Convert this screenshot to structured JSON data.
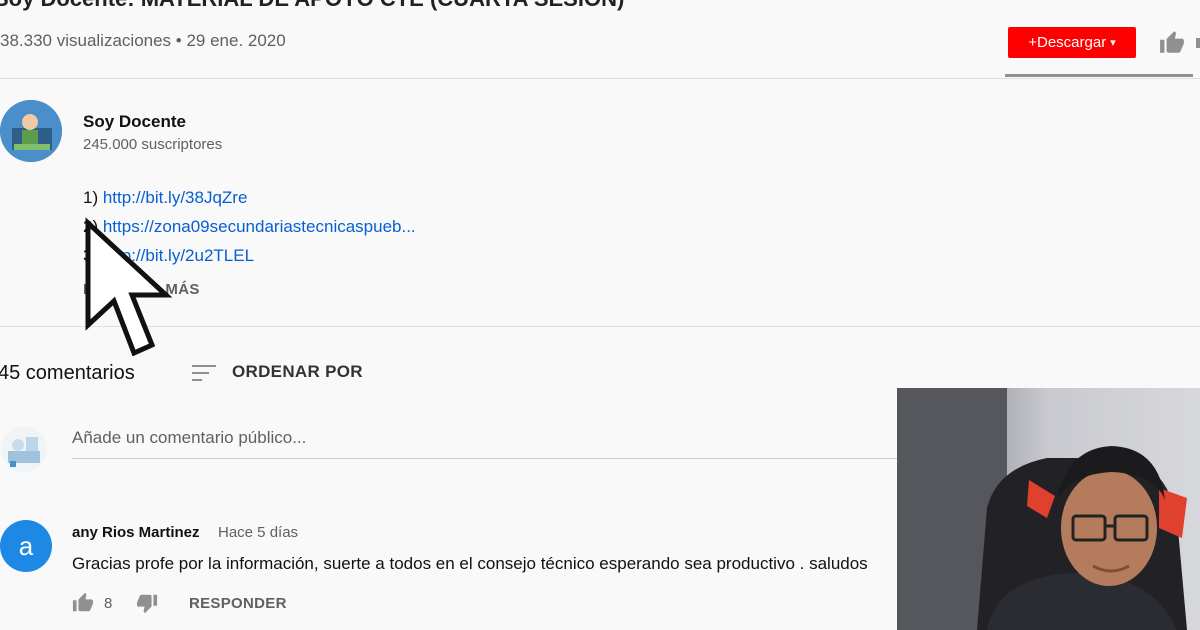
{
  "video": {
    "title": "Soy Docente: MATERIAL DE APOYO CTE (CUARTA SESIÓN)",
    "views_date": "38.330 visualizaciones • 29 ene. 2020",
    "download_label": "+Descargar",
    "download_caret": "▾"
  },
  "channel": {
    "name": "Soy Docente",
    "subscribers": "245.000 suscriptores"
  },
  "description": {
    "lines": [
      {
        "prefix": "1) ",
        "link": "http://bit.ly/38JqZre"
      },
      {
        "prefix": "2) ",
        "link": "https://zona09secundariastecnicaspueb..."
      },
      {
        "prefix": "3) ",
        "link": "http://bit.ly/2u2TLEL"
      }
    ],
    "show_more": "MOSTRAR MÁS"
  },
  "comments": {
    "count_label": "45 comentarios",
    "sort_label": "ORDENAR POR",
    "add_placeholder": "Añade un comentario público...",
    "items": [
      {
        "avatar_letter": "a",
        "author": "any Rios Martinez",
        "time": "Hace 5 días",
        "text": "Gracias profe por la información, suerte a todos en el consejo técnico esperando sea productivo . saludos",
        "likes": "8",
        "reply_label": "RESPONDER"
      }
    ]
  },
  "colors": {
    "accent": "#ff0000",
    "link": "#065fd4",
    "comment_avatar": "#1e88e5"
  },
  "icons": [
    "thumbs-up-icon",
    "thumbs-down-icon",
    "sort-icon",
    "cursor-icon"
  ]
}
